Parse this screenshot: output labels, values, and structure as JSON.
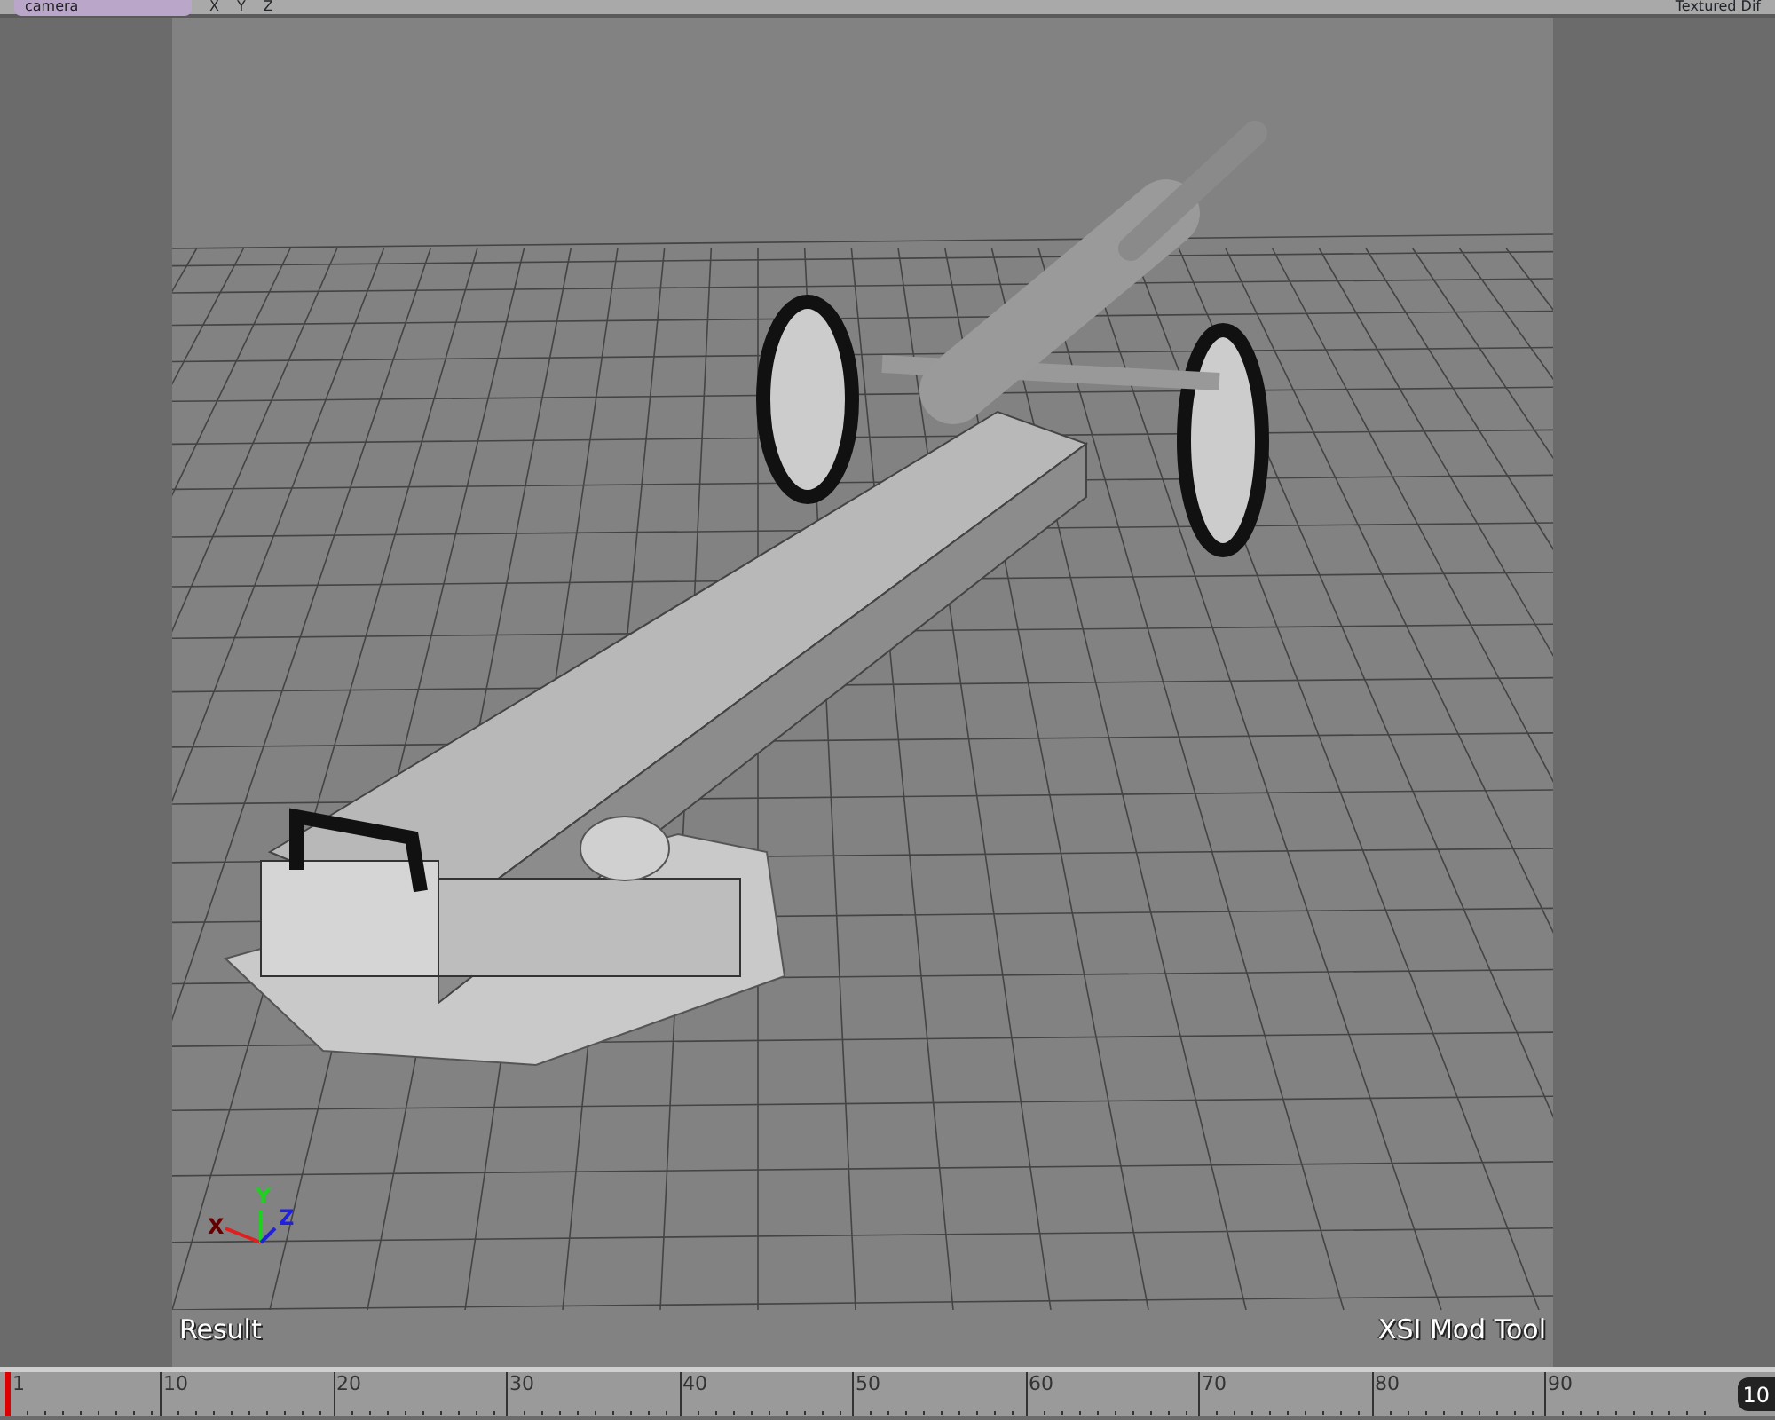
{
  "toolbar": {
    "view_menu": "camera",
    "axes": [
      "X",
      "Y",
      "Z"
    ],
    "display_mode": "Textured Dif"
  },
  "viewport": {
    "label_left": "Result",
    "label_right": "XSI Mod Tool",
    "axis_labels": [
      {
        "text": "X",
        "color": "#660000"
      },
      {
        "text": "Y",
        "color": "#20d020"
      },
      {
        "text": "Z",
        "color": "#2020e0"
      }
    ]
  },
  "timeline": {
    "ticks": [
      "1",
      "10",
      "20",
      "30",
      "40",
      "50",
      "60",
      "70",
      "80",
      "90"
    ],
    "end_frame": "10"
  }
}
